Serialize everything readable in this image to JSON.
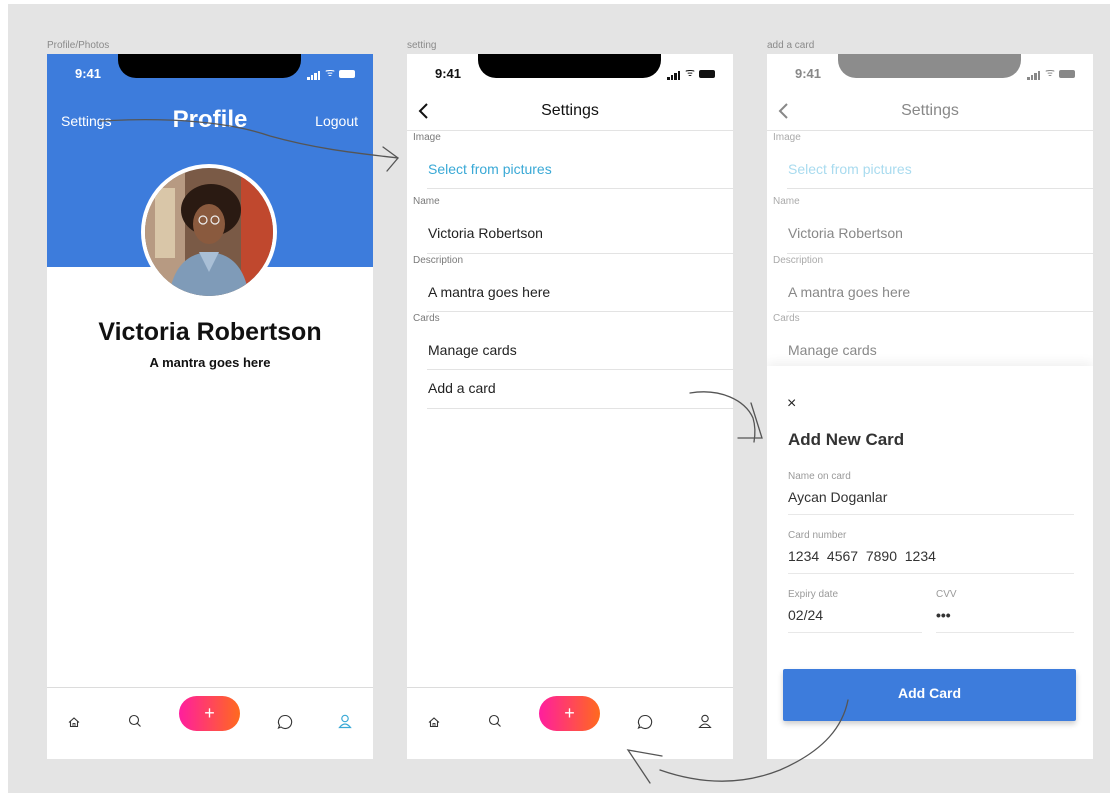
{
  "frame_labels": {
    "profile": "Profile/Photos",
    "settings": "setting",
    "add_card": "add a card"
  },
  "status_bar": {
    "time": "9:41"
  },
  "profile": {
    "settings_label": "Settings",
    "title": "Profile",
    "logout_label": "Logout",
    "name": "Victoria Robertson",
    "description": "A mantra goes here"
  },
  "settings": {
    "title": "Settings",
    "sections": {
      "image": "Image",
      "name": "Name",
      "description": "Description",
      "cards": "Cards"
    },
    "image_action": "Select from pictures",
    "name_value": "Victoria Robertson",
    "description_value": "A mantra goes here",
    "manage_cards": "Manage cards",
    "add_card": "Add a card"
  },
  "add_card_modal": {
    "close": "×",
    "title": "Add New Card",
    "name_label": "Name on card",
    "name_value": "Aycan Doganlar",
    "number_label": "Card number",
    "number_value": "1234  4567  7890  1234",
    "expiry_label": "Expiry date",
    "expiry_value": "02/24",
    "cvv_label": "CVV",
    "cvv_value": "•••",
    "submit_label": "Add Card"
  },
  "tab_bar": {
    "plus": "+",
    "active_tab": "profile",
    "active_color": "#3aa9d6"
  },
  "icons": [
    "home-icon",
    "search-icon",
    "plus-icon",
    "chat-icon",
    "user-icon",
    "back-chevron-icon",
    "close-icon",
    "signal-icon",
    "wifi-icon",
    "battery-icon"
  ],
  "colors": {
    "brand_blue": "#3d7cdc",
    "link_blue": "#3aa9d6",
    "gradient_start": "#ff1e9e",
    "gradient_end": "#ff6a1e",
    "canvas": "#e4e4e4"
  }
}
